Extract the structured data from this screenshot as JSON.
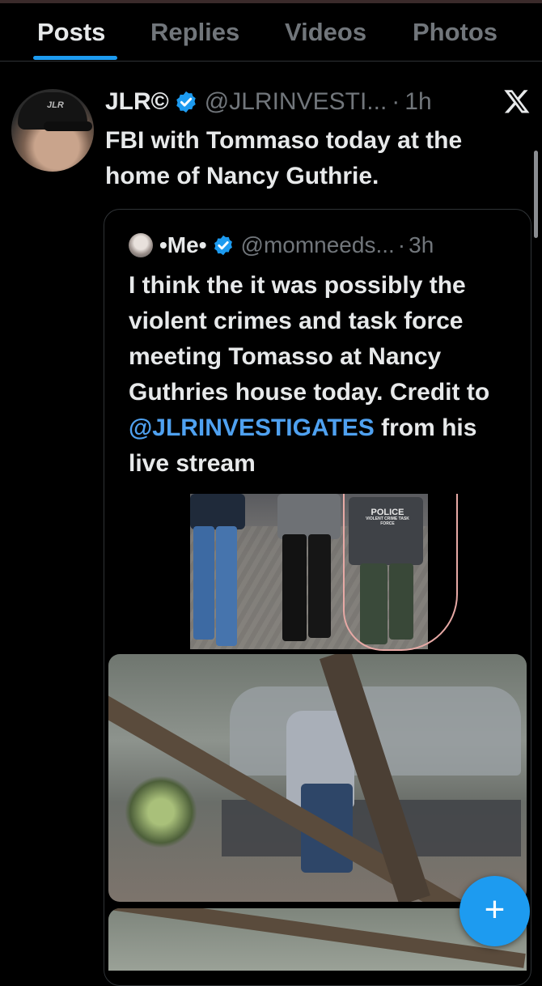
{
  "tabs": [
    {
      "label": "Posts",
      "active": true
    },
    {
      "label": "Replies",
      "active": false
    },
    {
      "label": "Videos",
      "active": false
    },
    {
      "label": "Photos",
      "active": false
    }
  ],
  "post": {
    "author_name": "JLR©",
    "handle": "@JLRINVESTI...",
    "separator": "·",
    "time": "1h",
    "text": "FBI with Tommaso today at the home of Nancy Guthrie.",
    "avatar_cap_text": "JLR"
  },
  "quoted": {
    "author_name": "•Me•",
    "handle": "@momneeds...",
    "separator": "·",
    "time": "3h",
    "text_before": "I think the it was possibly the violent crimes and task force meeting Tomasso at Nancy Guthries house today. Credit to ",
    "mention": "@JLRINVESTIGATES",
    "text_after": " from his live stream",
    "image_text_police": "POLICE",
    "image_text_unit": "VIOLENT CRIME TASK FORCE"
  },
  "fab": {
    "icon": "plus-icon",
    "label": "+"
  },
  "colors": {
    "accent": "#1d9bf0",
    "mention": "#4fa1f0",
    "muted": "#71767b",
    "background": "#000000"
  }
}
